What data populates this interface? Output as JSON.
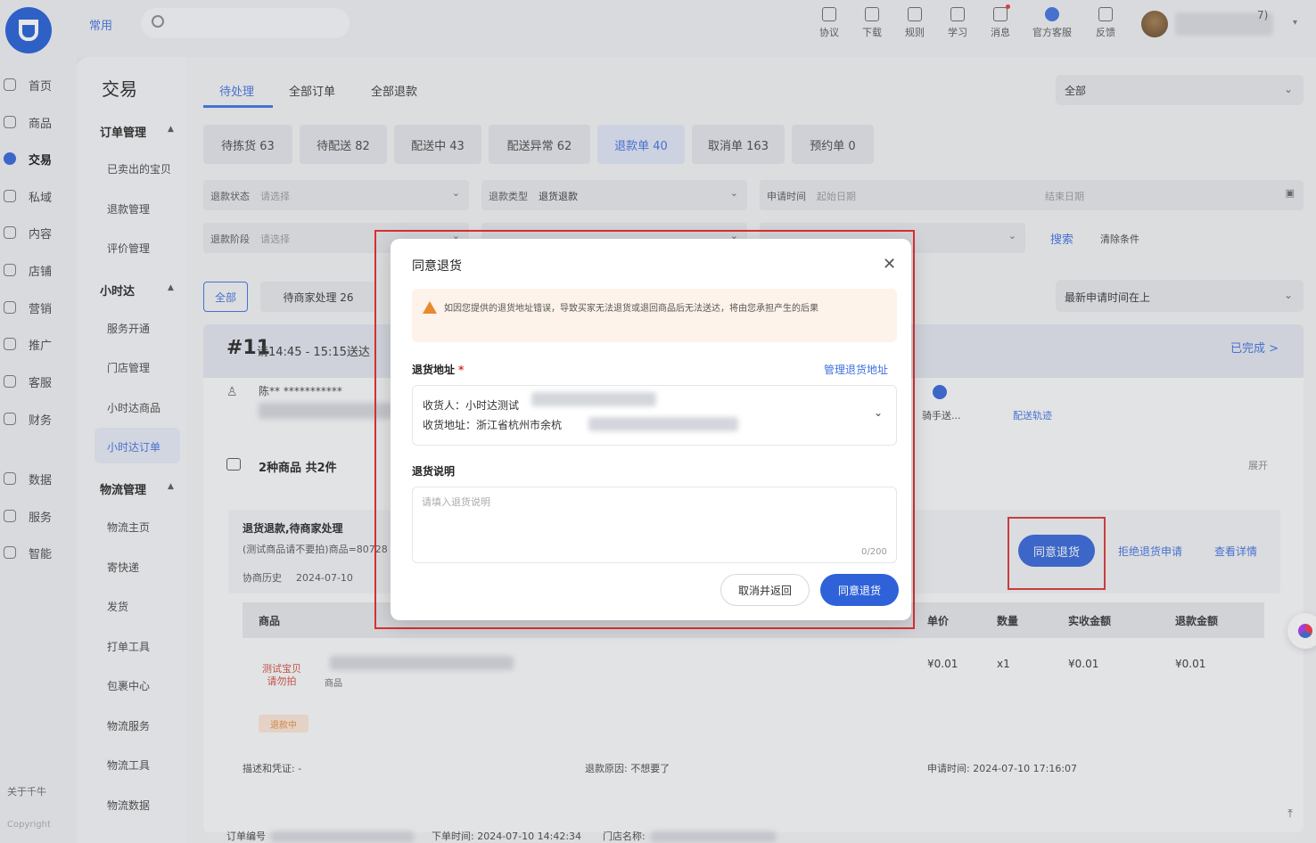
{
  "topbar": {
    "common_tab": "常用",
    "tools": [
      {
        "label": "协议",
        "icon": "doc-icon"
      },
      {
        "label": "下载",
        "icon": "download-icon"
      },
      {
        "label": "规则",
        "icon": "rule-icon"
      },
      {
        "label": "学习",
        "icon": "book-icon"
      },
      {
        "label": "消息",
        "icon": "message-icon"
      },
      {
        "label": "官方客服",
        "icon": "service-icon"
      },
      {
        "label": "反馈",
        "icon": "feedback-icon"
      }
    ],
    "user_tail": "7)"
  },
  "rail": {
    "items": [
      "首页",
      "商品",
      "交易",
      "私域",
      "内容",
      "店铺",
      "营销",
      "推广",
      "客服",
      "财务",
      "数据",
      "服务",
      "智能"
    ],
    "about": "关于千牛",
    "copyright": "Copyright"
  },
  "subnav": {
    "title": "交易",
    "groups": [
      {
        "label": "订单管理",
        "items": [
          "已卖出的宝贝",
          "退款管理",
          "评价管理"
        ]
      },
      {
        "label": "小时达",
        "items": [
          "服务开通",
          "门店管理",
          "小时达商品",
          "小时达订单"
        ]
      },
      {
        "label": "物流管理",
        "items": [
          "物流主页",
          "寄快递",
          "发货",
          "打单工具",
          "包裹中心",
          "物流服务",
          "物流工具",
          "物流数据"
        ]
      }
    ]
  },
  "main": {
    "tabs": [
      "待处理",
      "全部订单",
      "全部退款"
    ],
    "top_select": "全部",
    "stats": [
      "待拣货 63",
      "待配送 82",
      "配送中 43",
      "配送异常 62",
      "退款单 40",
      "取消单 163",
      "预约单 0"
    ],
    "filters": {
      "refund_status": {
        "label": "退款状态",
        "placeholder": "请选择"
      },
      "refund_type": {
        "label": "退款类型",
        "value": "退货退款"
      },
      "apply_time": {
        "label": "申请时间",
        "start": "起始日期",
        "end": "结束日期"
      },
      "refund_stage": {
        "label": "退款阶段",
        "placeholder": "请选择"
      },
      "search": "搜索",
      "clear": "清除条件"
    },
    "chips": {
      "all": "全部",
      "wait": "待商家处理 26"
    },
    "sort": "最新申请时间在上",
    "order": {
      "num": "#11",
      "time": "请14:45 - 15:15送达",
      "done": "已完成 >",
      "buyer": "陈** ***********",
      "rider": "骑手送...",
      "track": "配送轨迹",
      "goods": "2种商品 共2件",
      "expand": "展开",
      "refund_title": "退货退款,待商家处理",
      "refund_note": "(测试商品请不要拍)商品=80728",
      "history": "协商历史",
      "history_date": "2024-07-10",
      "agree": "同意退货",
      "reject": "拒绝退货申请",
      "detail": "查看详情",
      "table_headers": [
        "商品",
        "单价",
        "数量",
        "实收金额",
        "退款金额"
      ],
      "product_thumb": "测试宝贝\n请勿拍",
      "product_sub": "商品",
      "refund_tag": "退款中",
      "price": "¥0.01",
      "qty": "x1",
      "received": "¥0.01",
      "refund_amt": "¥0.01",
      "proof": "描述和凭证: -",
      "reason_label": "退款原因:",
      "reason": "不想要了",
      "apply_time_label": "申请时间:",
      "apply_time": "2024-07-10 17:16:07",
      "footer_order": "订单编号",
      "footer_time": "下单时间: 2024-07-10 14:42:34",
      "footer_store": "门店名称:"
    }
  },
  "modal": {
    "title": "同意退货",
    "warning": "如因您提供的退货地址错误，导致买家无法退货或退回商品后无法送达，将由您承担产生的后果",
    "address_label": "退货地址",
    "required_mark": "*",
    "manage_link": "管理退货地址",
    "receiver": "收货人：小时达测试",
    "address": "收货地址：浙江省杭州市余杭",
    "desc_label": "退货说明",
    "desc_placeholder": "请填入退货说明",
    "desc_count": "0/200",
    "cancel": "取消并返回",
    "confirm": "同意退货"
  },
  "colors": {
    "accent": "#2f62d8",
    "highlight": "#d93030",
    "warning": "#e8892b"
  }
}
